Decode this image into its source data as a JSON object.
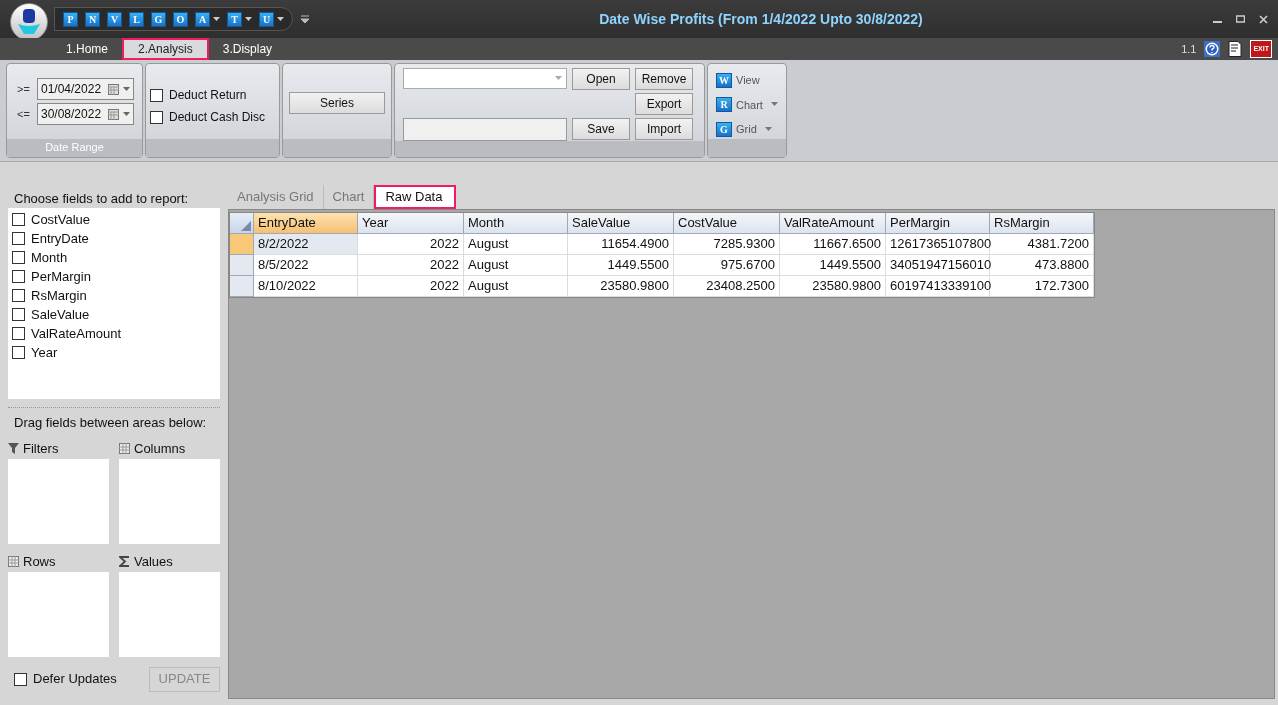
{
  "window": {
    "title": "Date Wise Profits (From 1/4/2022 Upto 30/8/2022)",
    "version": "1.1",
    "exit_label": "EXIT"
  },
  "quick_access": [
    {
      "letter": "P",
      "dropdown": false
    },
    {
      "letter": "N",
      "dropdown": false
    },
    {
      "letter": "V",
      "dropdown": false
    },
    {
      "letter": "L",
      "dropdown": false
    },
    {
      "letter": "G",
      "dropdown": false
    },
    {
      "letter": "O",
      "dropdown": false
    },
    {
      "letter": "A",
      "dropdown": true
    },
    {
      "letter": "T",
      "dropdown": true
    },
    {
      "letter": "U",
      "dropdown": true
    }
  ],
  "ribbon_tabs": [
    {
      "label": "1.Home",
      "selected": false
    },
    {
      "label": "2.Analysis",
      "selected": true
    },
    {
      "label": "3.Display",
      "selected": false
    }
  ],
  "date_range": {
    "caption": "Date Range",
    "from_label": ">=",
    "from": "01/04/2022",
    "to_label": "<=",
    "to": "30/08/2022"
  },
  "options": [
    {
      "label": "Deduct Return",
      "checked": false
    },
    {
      "label": "Deduct Cash Disc",
      "checked": false
    }
  ],
  "series_button": "Series",
  "layout_buttons": {
    "open": "Open",
    "remove": "Remove",
    "export": "Export",
    "save": "Save",
    "import": "Import"
  },
  "view_buttons": [
    {
      "icon_letter": "W",
      "label": "View",
      "dropdown": false
    },
    {
      "icon_letter": "R",
      "label": "Chart",
      "dropdown": true
    },
    {
      "icon_letter": "G",
      "label": "Grid",
      "dropdown": true
    }
  ],
  "field_list": {
    "heading": "Choose fields to add to report:",
    "fields": [
      {
        "label": "CostValue",
        "checked": false
      },
      {
        "label": "EntryDate",
        "checked": false
      },
      {
        "label": "Month",
        "checked": false
      },
      {
        "label": "PerMargin",
        "checked": false
      },
      {
        "label": "RsMargin",
        "checked": false
      },
      {
        "label": "SaleValue",
        "checked": false
      },
      {
        "label": "ValRateAmount",
        "checked": false
      },
      {
        "label": "Year",
        "checked": false
      }
    ]
  },
  "areas": {
    "heading": "Drag fields between areas below:",
    "items": [
      {
        "kind": "filter",
        "label": "Filters"
      },
      {
        "kind": "columns",
        "label": "Columns"
      },
      {
        "kind": "rows",
        "label": "Rows"
      },
      {
        "kind": "values",
        "label": "Values"
      }
    ]
  },
  "defer_updates": {
    "label": "Defer Updates",
    "checked": false
  },
  "update_button": {
    "label": "UPDATE",
    "disabled": true
  },
  "view_tabs": [
    {
      "label": "Analysis Grid",
      "selected": false
    },
    {
      "label": "Chart",
      "selected": false
    },
    {
      "label": "Raw Data",
      "selected": true
    }
  ],
  "table": {
    "columns": [
      {
        "label": "EntryDate"
      },
      {
        "label": "Year"
      },
      {
        "label": "Month"
      },
      {
        "label": "SaleValue"
      },
      {
        "label": "CostValue"
      },
      {
        "label": "ValRateAmount"
      },
      {
        "label": "PerMargin"
      },
      {
        "label": "RsMargin"
      }
    ],
    "rows": [
      {
        "selected": true,
        "cells": [
          "8/2/2022",
          "2022",
          "August",
          "11654.4900",
          "7285.9300",
          "11667.6500",
          "12617365107800",
          "4381.7200"
        ]
      },
      {
        "selected": false,
        "cells": [
          "8/5/2022",
          "2022",
          "August",
          "1449.5500",
          "975.6700",
          "1449.5500",
          "34051947156010",
          "473.8800"
        ]
      },
      {
        "selected": false,
        "cells": [
          "8/10/2022",
          "2022",
          "August",
          "23580.9800",
          "23408.2500",
          "23580.9800",
          "60197413339100",
          "172.7300"
        ]
      }
    ]
  }
}
